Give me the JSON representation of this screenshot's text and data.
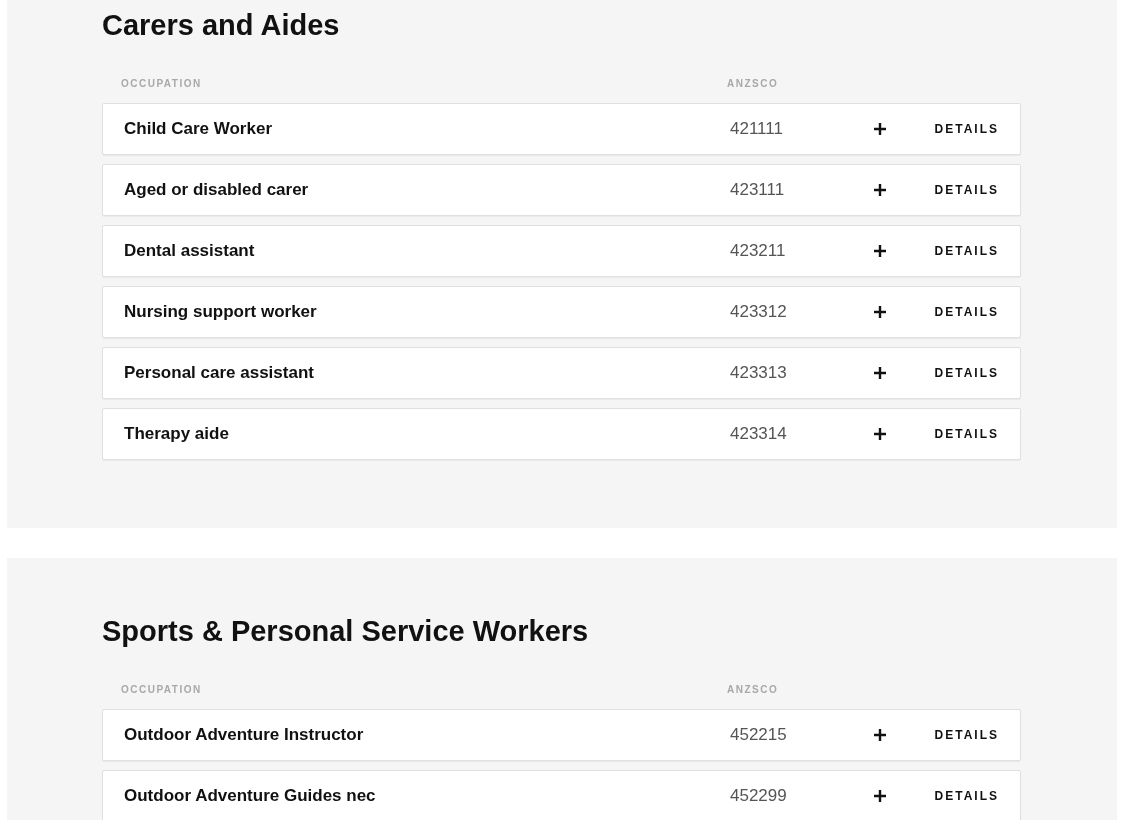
{
  "sections": [
    {
      "title": "Carers and Aides",
      "columns": [
        "OCCUPATION",
        "ANZSCO"
      ],
      "rows": [
        {
          "occupation": "Child Care Worker",
          "anzsco": "421111",
          "action": "DETAILS"
        },
        {
          "occupation": "Aged or disabled carer",
          "anzsco": "423111",
          "action": "DETAILS"
        },
        {
          "occupation": "Dental assistant",
          "anzsco": "423211",
          "action": "DETAILS"
        },
        {
          "occupation": "Nursing support worker",
          "anzsco": "423312",
          "action": "DETAILS"
        },
        {
          "occupation": "Personal care assistant",
          "anzsco": "423313",
          "action": "DETAILS"
        },
        {
          "occupation": "Therapy aide",
          "anzsco": "423314",
          "action": "DETAILS"
        }
      ]
    },
    {
      "title": "Sports & Personal Service Workers",
      "columns": [
        "OCCUPATION",
        "ANZSCO"
      ],
      "rows": [
        {
          "occupation": "Outdoor Adventure Instructor",
          "anzsco": "452215",
          "action": "DETAILS"
        },
        {
          "occupation": "Outdoor Adventure Guides nec",
          "anzsco": "452299",
          "action": "DETAILS"
        }
      ]
    }
  ]
}
